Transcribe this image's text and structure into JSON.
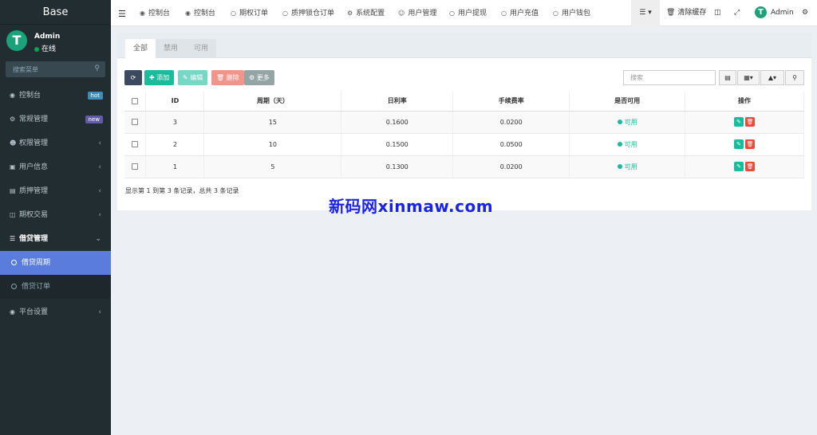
{
  "sidebar": {
    "logo": "Base",
    "user": {
      "name": "Admin",
      "status": "在线",
      "avatar_letter": "T",
      "avatar_color": "#1ba27a"
    },
    "search_placeholder": "搜索菜单",
    "items": [
      {
        "label": "控制台",
        "icon": "dashboard-icon",
        "badge": "hot"
      },
      {
        "label": "常规管理",
        "icon": "cogs-icon",
        "badge": "new"
      },
      {
        "label": "权限管理",
        "icon": "users-icon",
        "chevron": "‹"
      },
      {
        "label": "用户信息",
        "icon": "id-card-icon",
        "chevron": "‹"
      },
      {
        "label": "质押管理",
        "icon": "list-alt-icon",
        "chevron": "‹"
      },
      {
        "label": "期权交易",
        "icon": "file-icon",
        "chevron": "‹"
      },
      {
        "label": "借贷管理",
        "icon": "list-icon",
        "chevron": "⌄"
      },
      {
        "label": "平台设置",
        "icon": "circle-icon",
        "chevron": "‹"
      }
    ],
    "subitems": [
      {
        "label": "借贷周期",
        "active": true
      },
      {
        "label": "借贷订单",
        "active": false
      }
    ]
  },
  "topnav": {
    "tabs": [
      {
        "label": "控制台",
        "icon": "dashboard-icon"
      },
      {
        "label": "控制台",
        "icon": "dashboard-icon"
      },
      {
        "label": "期权订单",
        "icon": "circle-icon"
      },
      {
        "label": "质押锁仓订单",
        "icon": "circle-icon"
      },
      {
        "label": "系统配置",
        "icon": "gear-icon"
      },
      {
        "label": "用户管理",
        "icon": "user-circle-icon"
      },
      {
        "label": "用户提现",
        "icon": "circle-icon"
      },
      {
        "label": "用户充值",
        "icon": "circle-icon"
      },
      {
        "label": "用户钱包",
        "icon": "circle-icon"
      }
    ],
    "clear_cache": "清除缓存",
    "user_name": "Admin"
  },
  "content": {
    "tabs": [
      "全部",
      "禁用",
      "可用"
    ],
    "toolbar": {
      "add": "添加",
      "edit": "编辑",
      "delete": "删除",
      "more": "更多"
    },
    "search_placeholder": "搜索",
    "columns": [
      "ID",
      "周期（天）",
      "日利率",
      "手续费率",
      "是否可用",
      "操作"
    ],
    "rows": [
      {
        "id": "3",
        "period": "15",
        "rate": "0.1600",
        "fee": "0.0200",
        "status": "可用"
      },
      {
        "id": "2",
        "period": "10",
        "rate": "0.1500",
        "fee": "0.0500",
        "status": "可用"
      },
      {
        "id": "1",
        "period": "5",
        "rate": "0.1300",
        "fee": "0.0200",
        "status": "可用"
      }
    ],
    "summary": "显示第 1 到第 3 条记录，总共 3 条记录"
  },
  "watermark": "新码网xinmaw.com",
  "colors": {
    "sidebar_bg": "#222d32",
    "active_sub": "#5a7cdc",
    "success": "#18bc9c",
    "danger": "#e74c3c"
  }
}
